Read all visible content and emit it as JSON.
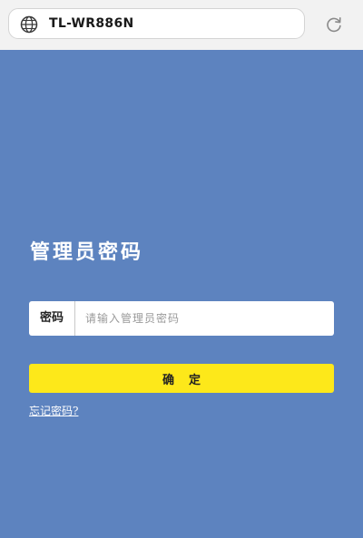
{
  "browser": {
    "url": "TL-WR886N",
    "globe_icon": "globe-icon",
    "reload_icon": "reload-icon"
  },
  "colors": {
    "page_background": "#5d83bf",
    "button_background": "#fde81a",
    "browser_bar": "#f2f2f2"
  },
  "login": {
    "title": "管理员密码",
    "password_label": "密码",
    "password_placeholder": "请输入管理员密码",
    "password_value": "",
    "confirm_label": "确定",
    "forgot_label": "忘记密码?"
  }
}
